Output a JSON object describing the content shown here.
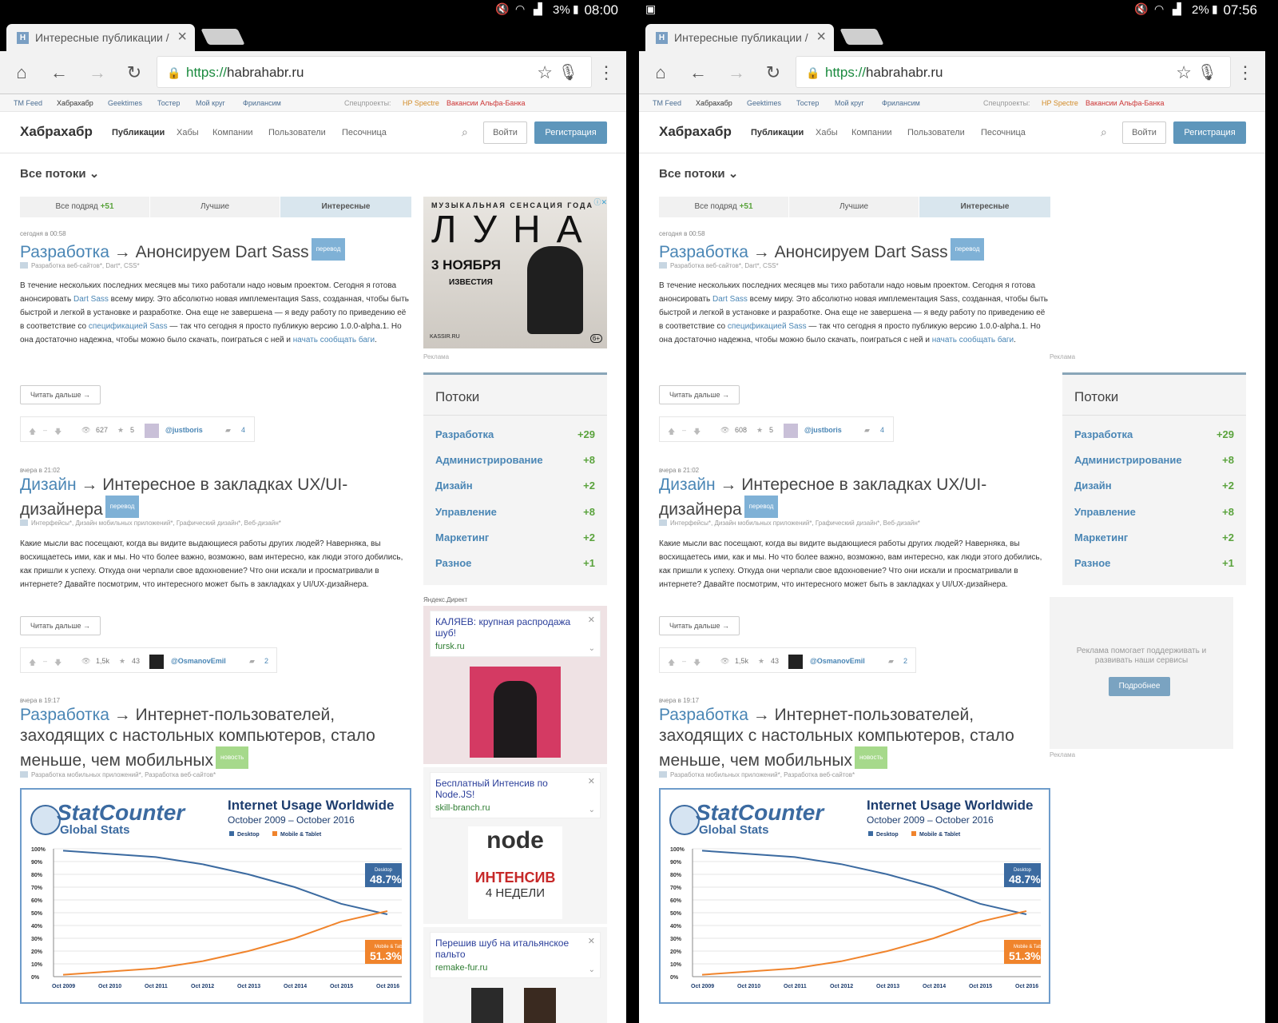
{
  "panes": [
    {
      "status": {
        "battery": "3%",
        "time": "08:00"
      },
      "tab": {
        "favicon": "H",
        "title": "Интересные публикации / "
      },
      "url": {
        "scheme": "https://",
        "host": "habrahabr.ru"
      },
      "post1_views": "627"
    },
    {
      "status": {
        "battery": "2%",
        "time": "07:56"
      },
      "tab": {
        "favicon": "H",
        "title": "Интересные публикации / "
      },
      "url": {
        "scheme": "https://",
        "host": "habrahabr.ru"
      },
      "post1_views": "608"
    }
  ],
  "topbar": {
    "links": [
      "TM Feed",
      "Хабрахабр",
      "Geektimes",
      "Тостер",
      "Мой круг",
      "Фрилансим"
    ],
    "special_label": "Спецпроекты:",
    "special1": "HP Spectre",
    "special2": "Вакансии Альфа-Банка"
  },
  "header": {
    "logo": "Хабрахабр",
    "nav": [
      "Публикации",
      "Хабы",
      "Компании",
      "Пользователи",
      "Песочница"
    ],
    "login": "Войти",
    "register": "Регистрация"
  },
  "flows_title": "Все потоки ⌄",
  "feed_tabs": {
    "all": "Все подряд",
    "all_count": "+51",
    "best": "Лучшие",
    "interesting": "Интересные"
  },
  "posts": [
    {
      "date": "сегодня в 00:58",
      "hub": "Разработка",
      "arrow": " → ",
      "title": "Анонсируем Dart Sass",
      "label": "перевод",
      "hubs": "Разработка веб-сайтов*, Dart*, CSS*",
      "body_a": "В течение нескольких последних месяцев мы тихо работали надо новым проектом. Сегодня я готова анонсировать ",
      "link1": "Dart Sass",
      "body_b": " всему миру. Это абсолютно новая имплементация Sass, созданная, чтобы быть быстрой и легкой в установке и разработке. Она еще не завершена — я веду работу по приведению её в соответствие со ",
      "link2": "спецификацией Sass",
      "body_c": " — так что сегодня я просто публикую версию 1.0.0-alpha.1. Но она достаточно надежна, чтобы можно было скачать, поиграться с ней и ",
      "link3": "начать сообщать баги",
      "body_d": ".",
      "read_more": "Читать дальше →",
      "favs": "5",
      "author": "@justboris",
      "comments": "4"
    },
    {
      "date": "вчера в 21:02",
      "hub": "Дизайн",
      "arrow": " → ",
      "title": "Интересное в закладках UX/UI-дизайнера",
      "label": "перевод",
      "hubs": "Интерфейсы*, Дизайн мобильных приложений*, Графический дизайн*, Веб-дизайн*",
      "body": "Какие мысли вас посещают, когда вы видите выдающиеся работы других людей? Наверняка, вы восхищаетесь ими, как и мы. Но что более важно, возможно, вам интересно, как люди этого добились, как пришли к успеху. Откуда они черпали свое вдохновение? Что они искали и просматривали в интернете? Давайте посмотрим, что интересного может быть в закладках у UI/UX-дизайнера.",
      "read_more": "Читать дальше →",
      "views": "1,5k",
      "favs": "43",
      "author": "@OsmanovEmil",
      "comments": "2"
    },
    {
      "date": "вчера в 19:17",
      "hub": "Разработка",
      "arrow": " → ",
      "title": "Интернет-пользователей, заходящих с настольных компьютеров, стало меньше, чем мобильных",
      "label": "новость",
      "hubs": "Разработка мобильных приложений*, Разработка веб-сайтов*"
    }
  ],
  "chart_data": {
    "type": "line",
    "logo_main": "StatCounter",
    "logo_sub": "Global Stats",
    "title": "Internet Usage Worldwide",
    "subtitle": "October 2009 – October 2016",
    "legend": [
      "Desktop",
      "Mobile & Tablet"
    ],
    "x": [
      "Oct 2009",
      "Oct 2010",
      "Oct 2011",
      "Oct 2012",
      "Oct 2013",
      "Oct 2014",
      "Oct 2015",
      "Oct 2016"
    ],
    "yticks": [
      "100%",
      "90%",
      "80%",
      "70%",
      "60%",
      "50%",
      "40%",
      "30%",
      "20%",
      "10%",
      "0%"
    ],
    "ylim": [
      0,
      100
    ],
    "series": [
      {
        "name": "Desktop",
        "color": "#3b6aa0",
        "values": [
          98.5,
          96,
          93.5,
          88,
          80,
          70,
          57,
          48.7
        ]
      },
      {
        "name": "Mobile & Tablet",
        "color": "#f0842c",
        "values": [
          1.5,
          4,
          6.5,
          12,
          20,
          30,
          43,
          51.3
        ]
      }
    ],
    "end_labels": [
      {
        "series": "Desktop",
        "value": "48.7%"
      },
      {
        "series": "Mobile & Tablet",
        "value": "51.3%"
      }
    ]
  },
  "ad_luna": {
    "top": "МУЗЫКАЛЬНАЯ СЕНСАЦИЯ ГОДА",
    "title": "ЛУНА",
    "date": "3 НОЯБРЯ",
    "brand": "ИЗВЕСТИЯ",
    "site": "KASSIR.RU",
    "age": "6+"
  },
  "ad_label": "Реклама",
  "streams": {
    "title": "Потоки",
    "items": [
      {
        "name": "Разработка",
        "count": "+29"
      },
      {
        "name": "Администрирование",
        "count": "+8"
      },
      {
        "name": "Дизайн",
        "count": "+2"
      },
      {
        "name": "Управление",
        "count": "+8"
      },
      {
        "name": "Маркетинг",
        "count": "+2"
      },
      {
        "name": "Разное",
        "count": "+1"
      }
    ]
  },
  "yandex": {
    "label": "Яндекс.Директ",
    "ads": [
      {
        "title": "КАЛЯЕВ: крупная распродажа шуб!",
        "domain": "fursk.ru"
      },
      {
        "title": "Бесплатный Интенсив по Node.JS!",
        "domain": "skill-branch.ru",
        "img_line1": "node",
        "img_line2": "ИНТЕНСИВ",
        "img_line3": "4 НЕДЕЛИ"
      },
      {
        "title": "Перешив шуб на итальянское пальто",
        "domain": "remake-fur.ru"
      }
    ]
  },
  "support": {
    "text": "Реклама помогает поддерживать и развивать наши сервисы",
    "button": "Подробнее"
  }
}
